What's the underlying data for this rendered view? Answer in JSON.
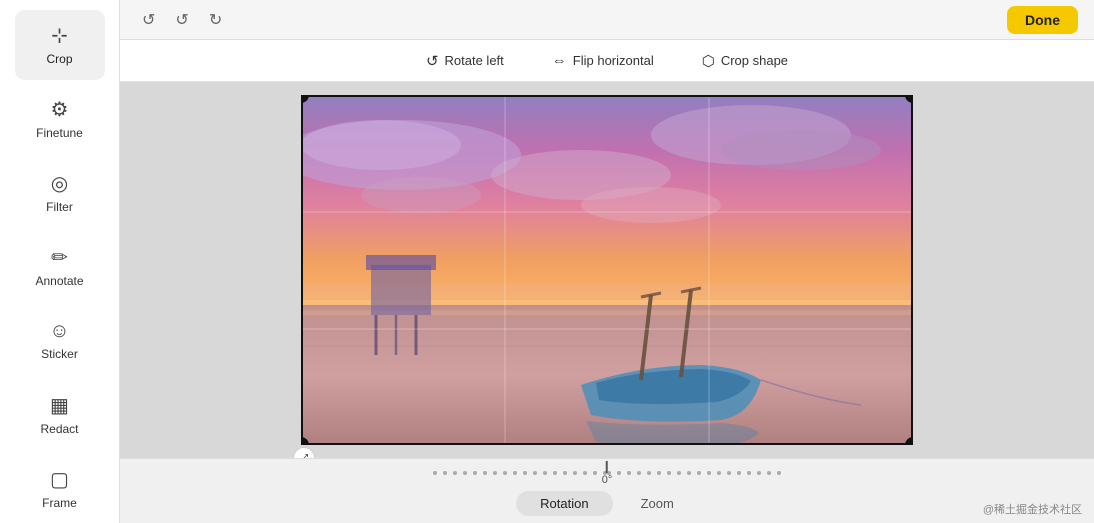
{
  "sidebar": {
    "items": [
      {
        "id": "crop",
        "label": "Crop",
        "icon": "⊞",
        "active": true
      },
      {
        "id": "finetune",
        "label": "Finetune",
        "icon": "|||",
        "active": false
      },
      {
        "id": "filter",
        "label": "Filter",
        "icon": "◎",
        "active": false
      },
      {
        "id": "annotate",
        "label": "Annotate",
        "icon": "✏",
        "active": false
      },
      {
        "id": "sticker",
        "label": "Sticker",
        "icon": "☺",
        "active": false
      },
      {
        "id": "redact",
        "label": "Redact",
        "icon": "▦",
        "active": false
      },
      {
        "id": "frame",
        "label": "Frame",
        "icon": "▢",
        "active": false
      }
    ]
  },
  "topbar": {
    "undo_label": "↺",
    "redo_label": "↻",
    "done_label": "Done"
  },
  "crop_toolbar": {
    "tools": [
      {
        "id": "rotate-left",
        "label": "Rotate left",
        "icon": "↺"
      },
      {
        "id": "flip-horizontal",
        "label": "Flip horizontal",
        "icon": "⇔"
      },
      {
        "id": "crop-shape",
        "label": "Crop shape",
        "icon": "⬡"
      }
    ]
  },
  "rotation_bar": {
    "angle": "0°",
    "dot_count_left": 18,
    "dot_count_right": 18
  },
  "mode_tabs": [
    {
      "id": "rotation",
      "label": "Rotation",
      "active": true
    },
    {
      "id": "zoom",
      "label": "Zoom",
      "active": false
    }
  ],
  "watermark": "@稀土掘金技术社区"
}
